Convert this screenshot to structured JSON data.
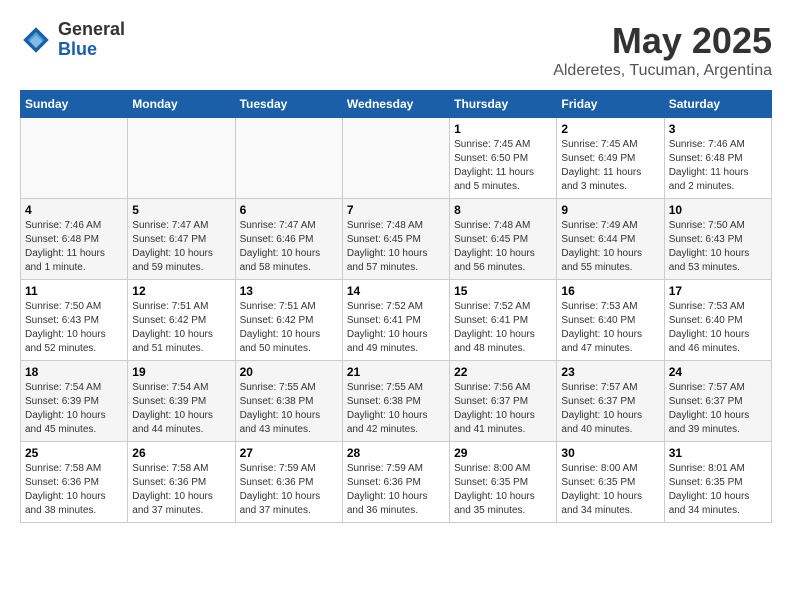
{
  "logo": {
    "general": "General",
    "blue": "Blue"
  },
  "title": "May 2025",
  "subtitle": "Alderetes, Tucuman, Argentina",
  "days_of_week": [
    "Sunday",
    "Monday",
    "Tuesday",
    "Wednesday",
    "Thursday",
    "Friday",
    "Saturday"
  ],
  "weeks": [
    [
      {
        "day": "",
        "info": ""
      },
      {
        "day": "",
        "info": ""
      },
      {
        "day": "",
        "info": ""
      },
      {
        "day": "",
        "info": ""
      },
      {
        "day": "1",
        "info": "Sunrise: 7:45 AM\nSunset: 6:50 PM\nDaylight: 11 hours\nand 5 minutes."
      },
      {
        "day": "2",
        "info": "Sunrise: 7:45 AM\nSunset: 6:49 PM\nDaylight: 11 hours\nand 3 minutes."
      },
      {
        "day": "3",
        "info": "Sunrise: 7:46 AM\nSunset: 6:48 PM\nDaylight: 11 hours\nand 2 minutes."
      }
    ],
    [
      {
        "day": "4",
        "info": "Sunrise: 7:46 AM\nSunset: 6:48 PM\nDaylight: 11 hours\nand 1 minute."
      },
      {
        "day": "5",
        "info": "Sunrise: 7:47 AM\nSunset: 6:47 PM\nDaylight: 10 hours\nand 59 minutes."
      },
      {
        "day": "6",
        "info": "Sunrise: 7:47 AM\nSunset: 6:46 PM\nDaylight: 10 hours\nand 58 minutes."
      },
      {
        "day": "7",
        "info": "Sunrise: 7:48 AM\nSunset: 6:45 PM\nDaylight: 10 hours\nand 57 minutes."
      },
      {
        "day": "8",
        "info": "Sunrise: 7:48 AM\nSunset: 6:45 PM\nDaylight: 10 hours\nand 56 minutes."
      },
      {
        "day": "9",
        "info": "Sunrise: 7:49 AM\nSunset: 6:44 PM\nDaylight: 10 hours\nand 55 minutes."
      },
      {
        "day": "10",
        "info": "Sunrise: 7:50 AM\nSunset: 6:43 PM\nDaylight: 10 hours\nand 53 minutes."
      }
    ],
    [
      {
        "day": "11",
        "info": "Sunrise: 7:50 AM\nSunset: 6:43 PM\nDaylight: 10 hours\nand 52 minutes."
      },
      {
        "day": "12",
        "info": "Sunrise: 7:51 AM\nSunset: 6:42 PM\nDaylight: 10 hours\nand 51 minutes."
      },
      {
        "day": "13",
        "info": "Sunrise: 7:51 AM\nSunset: 6:42 PM\nDaylight: 10 hours\nand 50 minutes."
      },
      {
        "day": "14",
        "info": "Sunrise: 7:52 AM\nSunset: 6:41 PM\nDaylight: 10 hours\nand 49 minutes."
      },
      {
        "day": "15",
        "info": "Sunrise: 7:52 AM\nSunset: 6:41 PM\nDaylight: 10 hours\nand 48 minutes."
      },
      {
        "day": "16",
        "info": "Sunrise: 7:53 AM\nSunset: 6:40 PM\nDaylight: 10 hours\nand 47 minutes."
      },
      {
        "day": "17",
        "info": "Sunrise: 7:53 AM\nSunset: 6:40 PM\nDaylight: 10 hours\nand 46 minutes."
      }
    ],
    [
      {
        "day": "18",
        "info": "Sunrise: 7:54 AM\nSunset: 6:39 PM\nDaylight: 10 hours\nand 45 minutes."
      },
      {
        "day": "19",
        "info": "Sunrise: 7:54 AM\nSunset: 6:39 PM\nDaylight: 10 hours\nand 44 minutes."
      },
      {
        "day": "20",
        "info": "Sunrise: 7:55 AM\nSunset: 6:38 PM\nDaylight: 10 hours\nand 43 minutes."
      },
      {
        "day": "21",
        "info": "Sunrise: 7:55 AM\nSunset: 6:38 PM\nDaylight: 10 hours\nand 42 minutes."
      },
      {
        "day": "22",
        "info": "Sunrise: 7:56 AM\nSunset: 6:37 PM\nDaylight: 10 hours\nand 41 minutes."
      },
      {
        "day": "23",
        "info": "Sunrise: 7:57 AM\nSunset: 6:37 PM\nDaylight: 10 hours\nand 40 minutes."
      },
      {
        "day": "24",
        "info": "Sunrise: 7:57 AM\nSunset: 6:37 PM\nDaylight: 10 hours\nand 39 minutes."
      }
    ],
    [
      {
        "day": "25",
        "info": "Sunrise: 7:58 AM\nSunset: 6:36 PM\nDaylight: 10 hours\nand 38 minutes."
      },
      {
        "day": "26",
        "info": "Sunrise: 7:58 AM\nSunset: 6:36 PM\nDaylight: 10 hours\nand 37 minutes."
      },
      {
        "day": "27",
        "info": "Sunrise: 7:59 AM\nSunset: 6:36 PM\nDaylight: 10 hours\nand 37 minutes."
      },
      {
        "day": "28",
        "info": "Sunrise: 7:59 AM\nSunset: 6:36 PM\nDaylight: 10 hours\nand 36 minutes."
      },
      {
        "day": "29",
        "info": "Sunrise: 8:00 AM\nSunset: 6:35 PM\nDaylight: 10 hours\nand 35 minutes."
      },
      {
        "day": "30",
        "info": "Sunrise: 8:00 AM\nSunset: 6:35 PM\nDaylight: 10 hours\nand 34 minutes."
      },
      {
        "day": "31",
        "info": "Sunrise: 8:01 AM\nSunset: 6:35 PM\nDaylight: 10 hours\nand 34 minutes."
      }
    ]
  ]
}
